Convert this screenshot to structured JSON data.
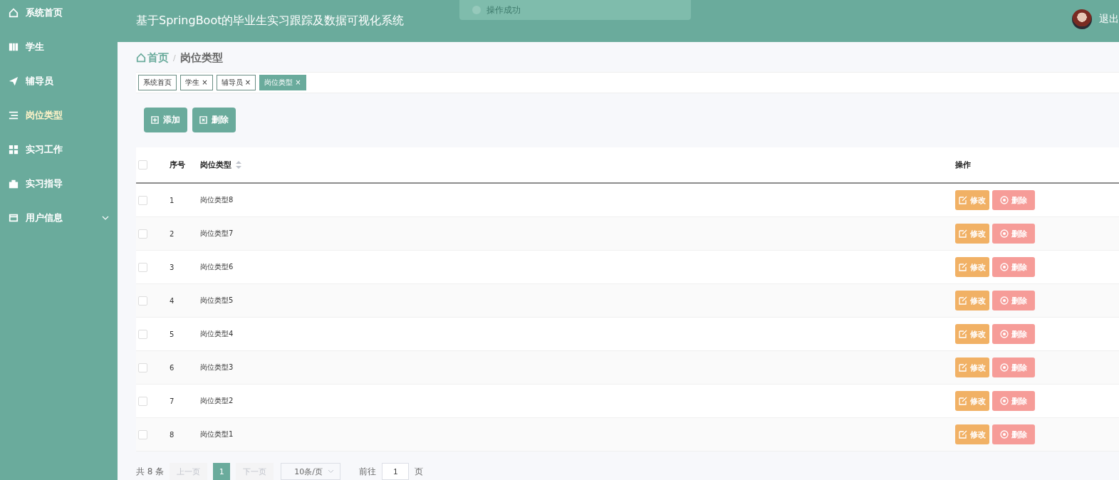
{
  "sidebar": {
    "items": [
      {
        "label": "系统首页",
        "selected": false,
        "expandable": false
      },
      {
        "label": "学生",
        "selected": false,
        "expandable": false
      },
      {
        "label": "辅导员",
        "selected": false,
        "expandable": false
      },
      {
        "label": "岗位类型",
        "selected": true,
        "expandable": false
      },
      {
        "label": "实习工作",
        "selected": false,
        "expandable": false
      },
      {
        "label": "实习指导",
        "selected": false,
        "expandable": false
      },
      {
        "label": "用户信息",
        "selected": false,
        "expandable": true
      }
    ]
  },
  "header": {
    "title": "基于SpringBoot的毕业生实习跟踪及数据可视化系统",
    "logout": "退出"
  },
  "toast": {
    "message": "操作成功"
  },
  "breadcrumb": {
    "home": "首页",
    "separator": "/",
    "current": "岗位类型"
  },
  "tags": [
    {
      "label": "系统首页",
      "selected": false
    },
    {
      "label": "学生",
      "close": "×",
      "selected": false
    },
    {
      "label": "辅导员",
      "close": "×",
      "selected": false
    },
    {
      "label": "岗位类型",
      "close": "×",
      "selected": true
    }
  ],
  "toolbar": [
    {
      "kind": "add",
      "label": "添加"
    },
    {
      "kind": "delete",
      "label": "删除"
    }
  ],
  "table": {
    "columns": [
      "序号",
      "岗位类型",
      "操作"
    ],
    "header_checked": false,
    "rows": [
      {
        "index": "1",
        "name": "岗位类型8",
        "checked": false,
        "actions": [
          {
            "kind": "edit",
            "label": "修改"
          },
          {
            "kind": "delete",
            "label": "删除"
          }
        ]
      },
      {
        "index": "2",
        "name": "岗位类型7",
        "checked": false,
        "actions": [
          {
            "kind": "edit",
            "label": "修改"
          },
          {
            "kind": "delete",
            "label": "删除"
          }
        ]
      },
      {
        "index": "3",
        "name": "岗位类型6",
        "checked": false,
        "actions": [
          {
            "kind": "edit",
            "label": "修改"
          },
          {
            "kind": "delete",
            "label": "删除"
          }
        ]
      },
      {
        "index": "4",
        "name": "岗位类型5",
        "checked": false,
        "actions": [
          {
            "kind": "edit",
            "label": "修改"
          },
          {
            "kind": "delete",
            "label": "删除"
          }
        ]
      },
      {
        "index": "5",
        "name": "岗位类型4",
        "checked": false,
        "actions": [
          {
            "kind": "edit",
            "label": "修改"
          },
          {
            "kind": "delete",
            "label": "删除"
          }
        ]
      },
      {
        "index": "6",
        "name": "岗位类型3",
        "checked": false,
        "actions": [
          {
            "kind": "edit",
            "label": "修改"
          },
          {
            "kind": "delete",
            "label": "删除"
          }
        ]
      },
      {
        "index": "7",
        "name": "岗位类型2",
        "checked": false,
        "actions": [
          {
            "kind": "edit",
            "label": "修改"
          },
          {
            "kind": "delete",
            "label": "删除"
          }
        ]
      },
      {
        "index": "8",
        "name": "岗位类型1",
        "checked": false,
        "actions": [
          {
            "kind": "edit",
            "label": "修改"
          },
          {
            "kind": "delete",
            "label": "删除"
          }
        ]
      }
    ]
  },
  "pagination": {
    "total": "共 8 条",
    "prev": "上一页",
    "pages": [
      {
        "label": "1",
        "selected": true
      }
    ],
    "next": "下一页",
    "page_size": "10条/页",
    "goto_label": "前往",
    "goto_value": "1",
    "goto_suffix": "页"
  }
}
